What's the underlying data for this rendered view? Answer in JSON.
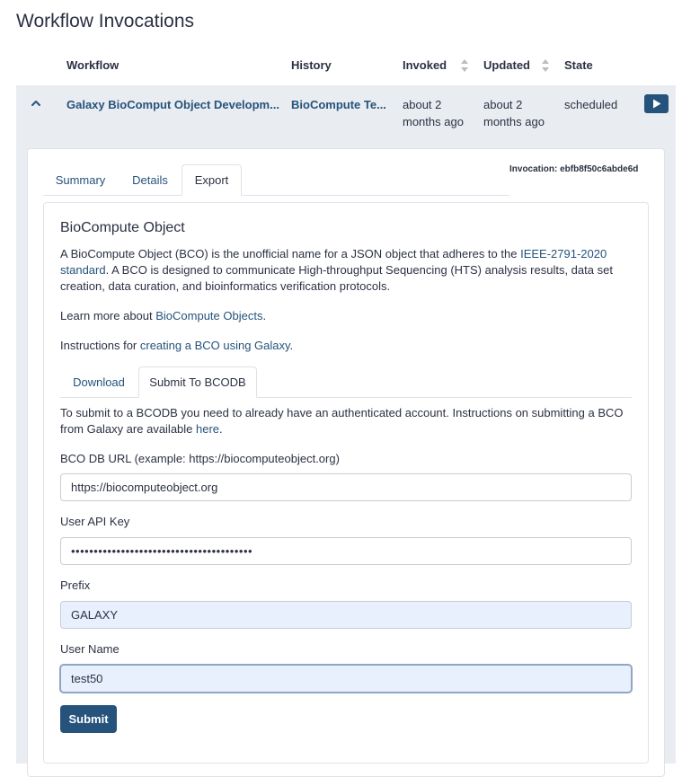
{
  "page": {
    "title": "Workflow Invocations"
  },
  "table": {
    "headers": {
      "workflow": "Workflow",
      "history": "History",
      "invoked": "Invoked",
      "updated": "Updated",
      "state": "State"
    },
    "row": {
      "workflow": "Galaxy BioComput Object Developm...",
      "history": "BioCompute Te...",
      "invoked_line1": "about 2",
      "invoked_line2": "months ago",
      "updated_line1": "about 2",
      "updated_line2": "months ago",
      "state": "scheduled"
    }
  },
  "invocation": {
    "id_text": "Invocation: ebfb8f50c6abde6d",
    "tabs": [
      "Summary",
      "Details",
      "Export"
    ],
    "active_tab": "Export"
  },
  "bco": {
    "title": "BioCompute Object",
    "desc_part1": "A BioCompute Object (BCO) is the unofficial name for a JSON object that adheres to the ",
    "ieee_link_line1": "IEEE-2791-2020",
    "ieee_link_line2": "standard",
    "desc_part2_line1": ". A BCO is designed to communicate High-throughput Sequencing (HTS) analysis results, data set",
    "desc_part2_line2": "creation, data curation, and bioinformatics verification protocols.",
    "learn_prefix": "Learn more about ",
    "learn_link": "BioCompute Objects",
    "learn_suffix": ".",
    "instr_prefix": "Instructions for ",
    "instr_link": "creating a BCO using Galaxy",
    "instr_suffix": "."
  },
  "export_tabs": {
    "download": "Download",
    "submit": "Submit To BCODB"
  },
  "submit_form": {
    "intro_line1": "To submit to a BCODB you need to already have an authenticated account. Instructions on submitting a BCO",
    "intro_line2_prefix": "from Galaxy are available ",
    "intro_link": "here",
    "intro_suffix": ".",
    "url_label": "BCO DB URL (example: https://biocomputeobject.org)",
    "url_value": "https://biocomputeobject.org",
    "api_key_label": "User API Key",
    "api_key_value": "••••••••••••••••••••••••••••••••••••••••",
    "prefix_label": "Prefix",
    "prefix_value": "GALAXY",
    "username_label": "User Name",
    "username_value": "test50",
    "submit_label": "Submit"
  },
  "colors": {
    "link": "#25537b",
    "band": "#e9ecf1",
    "button": "#25537b"
  }
}
